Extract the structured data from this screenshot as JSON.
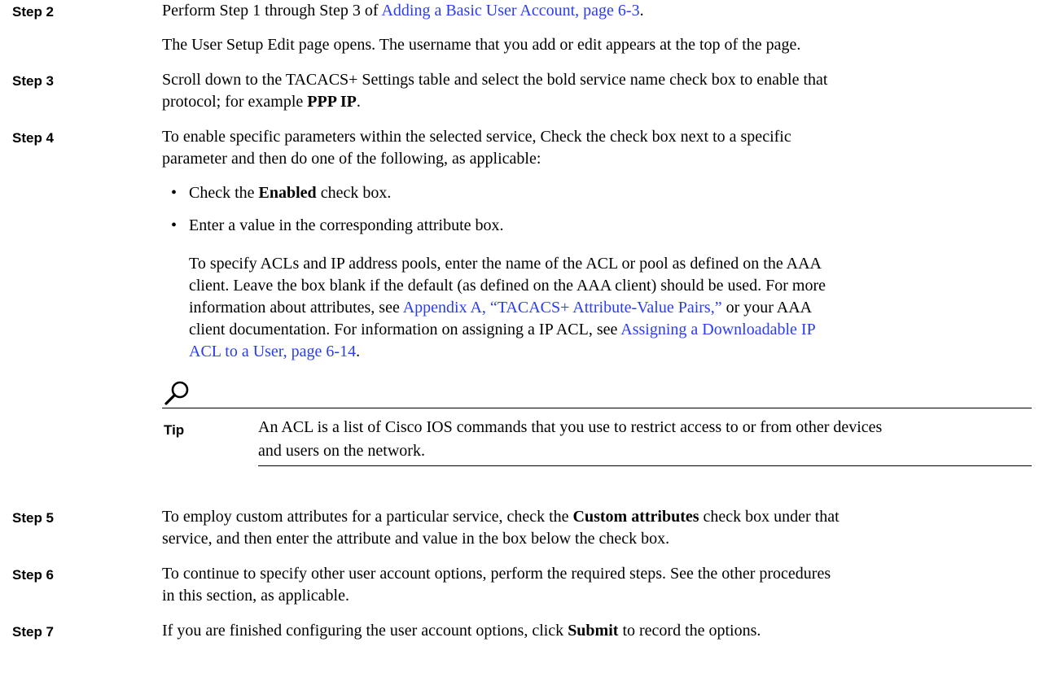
{
  "steps": {
    "s2": {
      "label": "Step 2",
      "l1_a": "Perform Step 1 through Step 3 of ",
      "l1_link": "Adding a Basic User Account, page 6-3",
      "l1_b": ".",
      "l2": "The User Setup Edit page opens. The username that you add or edit appears at the top of the page."
    },
    "s3": {
      "label": "Step 3",
      "l1": "Scroll down to the TACACS+ Settings table and select the bold service name check box to enable that",
      "l2_a": "protocol; for example ",
      "l2_bold": "PPP IP",
      "l2_b": "."
    },
    "s4": {
      "label": "Step 4",
      "l1": "To enable specific parameters within the selected service, Check the check box next to a specific",
      "l2": "parameter and then do one of the following, as applicable:",
      "bullet1_a": "Check the ",
      "bullet1_bold": "Enabled",
      "bullet1_b": " check box.",
      "bullet2": "Enter a value in the corresponding attribute box.",
      "p_l1": "To specify ACLs and IP address pools, enter the name of the ACL or pool as defined on the AAA",
      "p_l2": "client. Leave the box blank if the default (as defined on the AAA client) should be used. For more",
      "p_l3_a": "information about attributes, see ",
      "p_l3_link": "Appendix A, “TACACS+ Attribute-Value Pairs,”",
      "p_l3_b": " or your AAA",
      "p_l4_a": "client documentation. For information on assigning a IP ACL, see ",
      "p_l4_link": "Assigning a Downloadable IP",
      "p_l5_link": "ACL to a User, page 6-14",
      "p_l5_b": "."
    },
    "tip": {
      "label": "Tip",
      "l1": "An ACL is a list of Cisco IOS commands that you use to restrict access to or from other devices",
      "l2": "and users on the network."
    },
    "s5": {
      "label": "Step 5",
      "l1_a": "To employ custom attributes for a particular service, check the ",
      "l1_bold": "Custom attributes",
      "l1_b": " check box under that",
      "l2": "service, and then enter the attribute and value in the box below the check box."
    },
    "s6": {
      "label": "Step 6",
      "l1": "To continue to specify other user account options, perform the required steps. See the other procedures",
      "l2": "in this section, as applicable."
    },
    "s7": {
      "label": "Step 7",
      "l1_a": "If you are finished configuring the user account options, click ",
      "l1_bold": "Submit",
      "l1_b": " to record the options."
    }
  },
  "icons": {
    "tip": "magnifier-icon"
  },
  "colors": {
    "link": "#2a3cf0"
  }
}
